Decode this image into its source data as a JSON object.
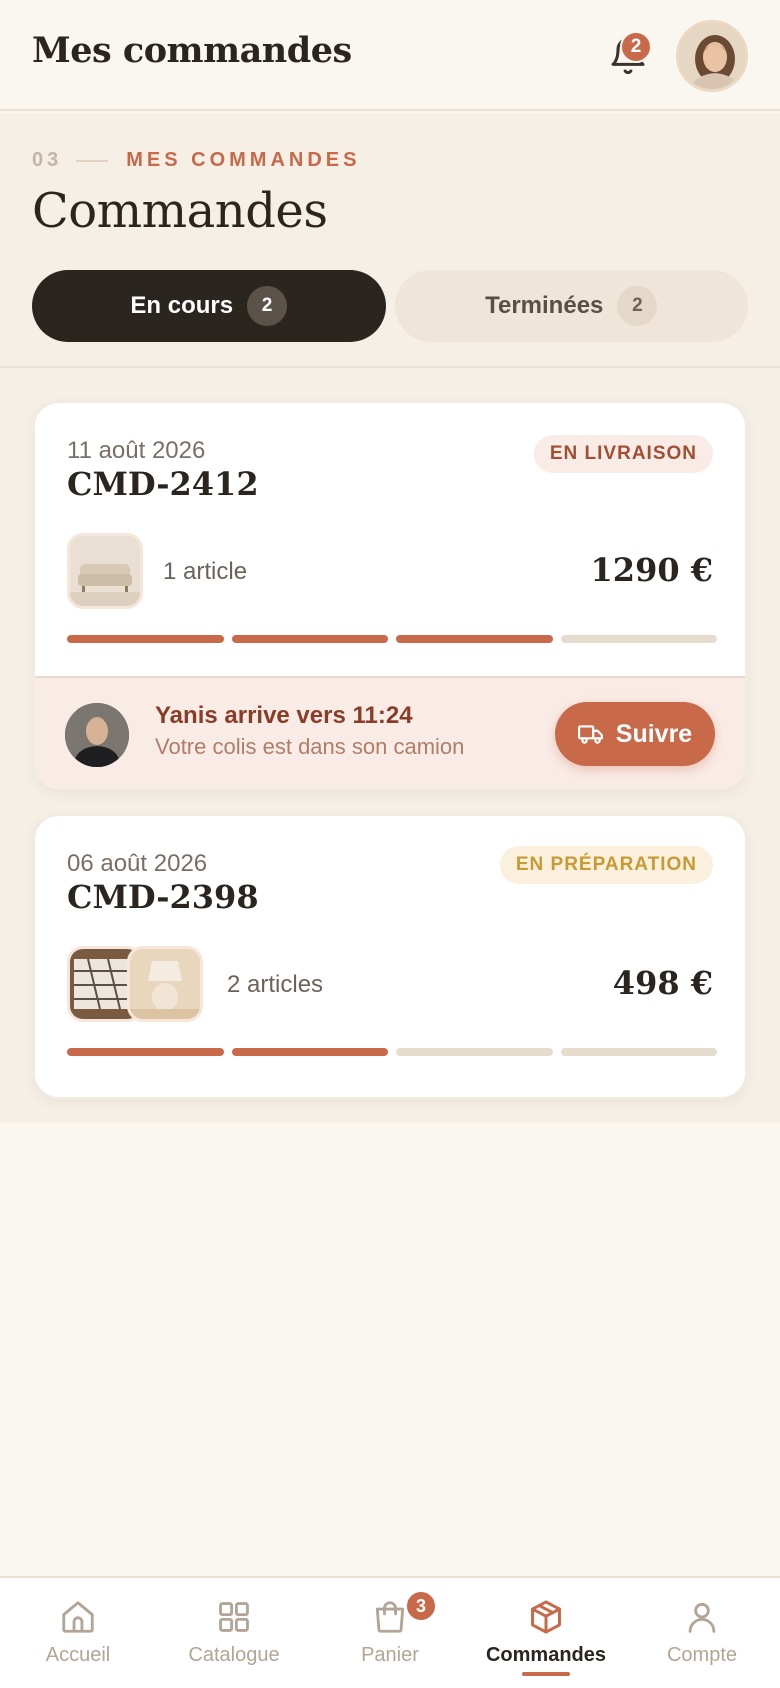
{
  "header": {
    "title": "Mes commandes",
    "notifications_count": "2"
  },
  "section": {
    "number": "03",
    "eyebrow": "MES COMMANDES",
    "title": "Commandes",
    "tabs": [
      {
        "label": "En cours",
        "count": "2",
        "active": true
      },
      {
        "label": "Terminées",
        "count": "2",
        "active": false
      }
    ]
  },
  "orders": [
    {
      "date": "11 août 2026",
      "ref": "CMD-2412",
      "status": "EN LIVRAISON",
      "items_text": "1 article",
      "thumbnails": [
        "sofa"
      ],
      "price": "1290 €",
      "progress_steps_done": 3,
      "progress_steps_total": 4,
      "courier": {
        "title": "Yanis arrive vers 11:24",
        "subtitle": "Votre colis est dans son camion",
        "button": "Suivre",
        "button_icon": "truck-icon"
      }
    },
    {
      "date": "06 août 2026",
      "ref": "CMD-2398",
      "status": "EN PRÉPARATION",
      "items_text": "2 articles",
      "thumbnails": [
        "rug",
        "lamp"
      ],
      "price": "498 €",
      "progress_steps_done": 2,
      "progress_steps_total": 4
    }
  ],
  "bottom_nav": [
    {
      "label": "Accueil",
      "icon": "home-icon"
    },
    {
      "label": "Catalogue",
      "icon": "grid-icon"
    },
    {
      "label": "Panier",
      "icon": "bag-icon",
      "badge": "3"
    },
    {
      "label": "Commandes",
      "icon": "box-icon",
      "active": true
    },
    {
      "label": "Compte",
      "icon": "user-icon"
    }
  ],
  "colors": {
    "accent": "#c8694a",
    "dark": "#2b2520",
    "background": "#faf6f0"
  }
}
